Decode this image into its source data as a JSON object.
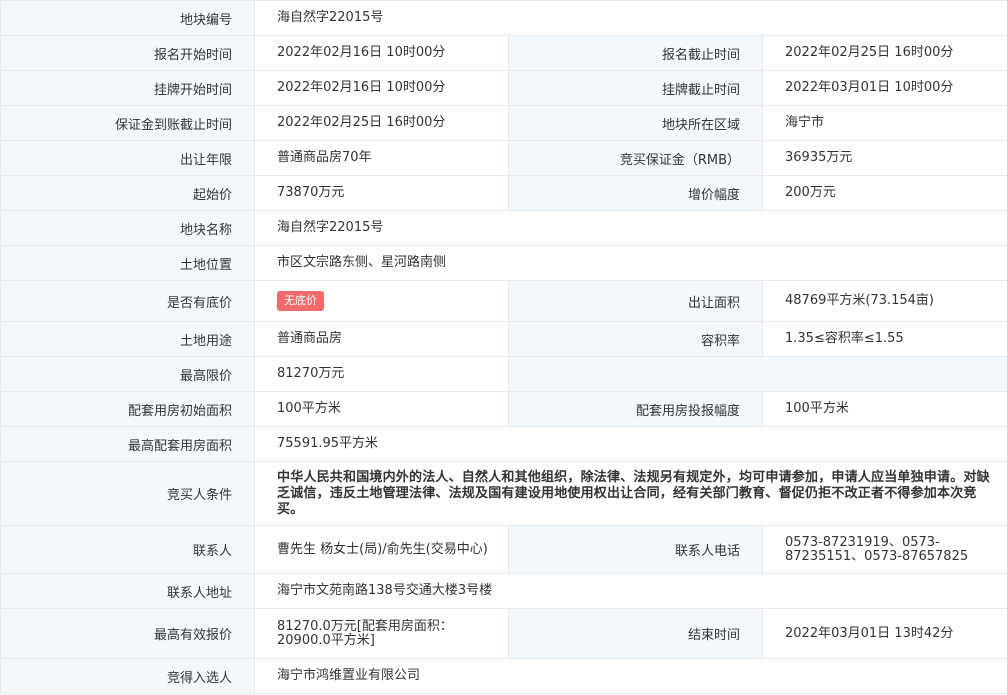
{
  "rows": {
    "r1": {
      "l1": "地块编号",
      "v1": "海自然字22015号"
    },
    "r2": {
      "l1": "报名开始时间",
      "v1": "2022年02月16日 10时00分",
      "l2": "报名截止时间",
      "v2": "2022年02月25日 16时00分"
    },
    "r3": {
      "l1": "挂牌开始时间",
      "v1": "2022年02月16日 10时00分",
      "l2": "挂牌截止时间",
      "v2": "2022年03月01日 10时00分"
    },
    "r4": {
      "l1": "保证金到账截止时间",
      "v1": "2022年02月25日 16时00分",
      "l2": "地块所在区域",
      "v2": "海宁市"
    },
    "r5": {
      "l1": "出让年限",
      "v1": "普通商品房70年",
      "l2": "竞买保证金（RMB）",
      "v2": "36935万元"
    },
    "r6": {
      "l1": "起始价",
      "v1": "73870万元",
      "l2": "增价幅度",
      "v2": "200万元"
    },
    "r7": {
      "l1": "地块名称",
      "v1": "海自然字22015号"
    },
    "r8": {
      "l1": "土地位置",
      "v1": "市区文宗路东侧、星河路南侧"
    },
    "r9": {
      "l1": "是否有底价",
      "badge": "无底价",
      "l2": "出让面积",
      "v2": "48769平方米(73.154亩)"
    },
    "r10": {
      "l1": "土地用途",
      "v1": "普通商品房",
      "l2": "容积率",
      "v2": "1.35≤容积率≤1.55"
    },
    "r11": {
      "l1": "最高限价",
      "v1": "81270万元"
    },
    "r12": {
      "l1": "配套用房初始面积",
      "v1": "100平方米",
      "l2": "配套用房投报幅度",
      "v2": "100平方米"
    },
    "r13": {
      "l1": "最高配套用房面积",
      "v1": "75591.95平方米"
    },
    "r14": {
      "l1": "竞买人条件",
      "v1": "中华人民共和国境内外的法人、自然人和其他组织，除法律、法规另有规定外，均可申请参加，申请人应当单独申请。对缺乏诚信，违反土地管理法律、法规及国有建设用地使用权出让合同，经有关部门教育、督促仍拒不改正者不得参加本次竞买。"
    },
    "r15": {
      "l1": "联系人",
      "v1": "曹先生 杨女士(局)/俞先生(交易中心)",
      "l2": "联系人电话",
      "v2": "0573-87231919、0573-87235151、0573-87657825"
    },
    "r16": {
      "l1": "联系人地址",
      "v1": "海宁市文苑南路138号交通大楼3号楼"
    },
    "r17": {
      "l1": "最高有效报价",
      "v1": "81270.0万元[配套用房面积：20900.0平方米]",
      "l2": "结束时间",
      "v2": "2022年03月01日 13时42分"
    },
    "r18": {
      "l1": "竞得入选人",
      "v1": "海宁市鸿维置业有限公司"
    }
  },
  "colors": {
    "label_bg": "#f3f8fc",
    "border": "#e3eaf1",
    "badge_bg": "#f26b6b",
    "text": "#333333"
  }
}
